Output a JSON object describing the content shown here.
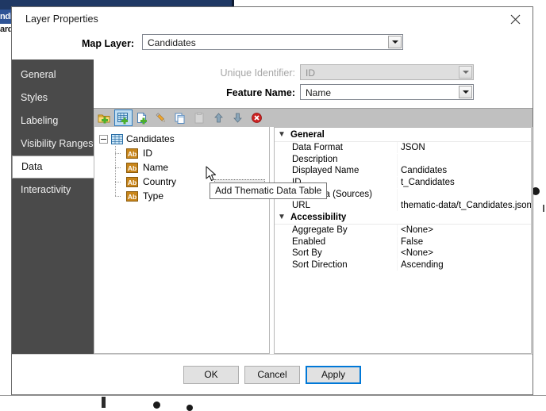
{
  "background": {
    "selected_text": "ndi",
    "secondary_text": "ard"
  },
  "dialog": {
    "title": "Layer Properties",
    "close_icon": "close-icon"
  },
  "map_layer": {
    "label": "Map Layer:",
    "value": "Candidates"
  },
  "identifiers": {
    "unique_identifier": {
      "label": "Unique Identifier:",
      "value": "ID",
      "disabled": true
    },
    "feature_name": {
      "label": "Feature Name:",
      "value": "Name",
      "disabled": false
    }
  },
  "sidebar": {
    "items": [
      {
        "label": "General",
        "selected": false
      },
      {
        "label": "Styles",
        "selected": false
      },
      {
        "label": "Labeling",
        "selected": false
      },
      {
        "label": "Visibility Ranges",
        "selected": false
      },
      {
        "label": "Data",
        "selected": true
      },
      {
        "label": "Interactivity",
        "selected": false
      }
    ]
  },
  "toolbar": {
    "buttons": [
      {
        "icon": "add-data-source-folder-icon",
        "title": "Add Data Source",
        "active": false,
        "enabled": true
      },
      {
        "icon": "add-thematic-data-table-icon",
        "title": "Add Thematic Data Table",
        "active": true,
        "enabled": true
      },
      {
        "icon": "add-data-field-icon",
        "title": "Add Data Field",
        "active": false,
        "enabled": true
      },
      {
        "icon": "edit-pencil-icon",
        "title": "Edit",
        "active": false,
        "enabled": true
      },
      {
        "icon": "copy-icon",
        "title": "Copy",
        "active": false,
        "enabled": true
      },
      {
        "icon": "paste-icon",
        "title": "Paste",
        "active": false,
        "enabled": false
      },
      {
        "icon": "move-up-arrow-icon",
        "title": "Move Up",
        "active": false,
        "enabled": true
      },
      {
        "icon": "move-down-arrow-icon",
        "title": "Move Down",
        "active": false,
        "enabled": true
      },
      {
        "icon": "delete-icon",
        "title": "Delete",
        "active": false,
        "enabled": true
      }
    ]
  },
  "tooltip": {
    "text": "Add Thematic Data Table"
  },
  "tree": {
    "root": {
      "label": "Candidates",
      "icon": "table-icon",
      "expanded": true
    },
    "children": [
      {
        "label": "ID",
        "icon": "text-field-icon"
      },
      {
        "label": "Name",
        "icon": "text-field-icon"
      },
      {
        "label": "Country",
        "icon": "text-field-icon"
      },
      {
        "label": "Type",
        "icon": "text-field-icon"
      }
    ]
  },
  "properties": {
    "groups": [
      {
        "name": "General",
        "expanded": true,
        "rows": [
          {
            "name": "Data Format",
            "value": "JSON"
          },
          {
            "name": "Description",
            "value": ""
          },
          {
            "name": "Displayed Name",
            "value": "Candidates"
          },
          {
            "name": "ID",
            "value": "t_Candidates"
          },
          {
            "name": "Metadata (Sources)",
            "value": ""
          },
          {
            "name": "URL",
            "value": "thematic-data/t_Candidates.json"
          }
        ]
      },
      {
        "name": "Accessibility",
        "expanded": true,
        "rows": [
          {
            "name": "Aggregate By",
            "value": "<None>"
          },
          {
            "name": "Enabled",
            "value": "False"
          },
          {
            "name": "Sort By",
            "value": "<None>"
          },
          {
            "name": "Sort Direction",
            "value": "Ascending"
          }
        ]
      }
    ]
  },
  "footer": {
    "ok": "OK",
    "cancel": "Cancel",
    "apply": "Apply"
  },
  "colors": {
    "sidebar_bg": "#4a4a4a",
    "toolbar_bg": "#c0c0c0",
    "accent": "#0078d7",
    "delete_red": "#cc2222",
    "field_icon": "#c8851a"
  }
}
